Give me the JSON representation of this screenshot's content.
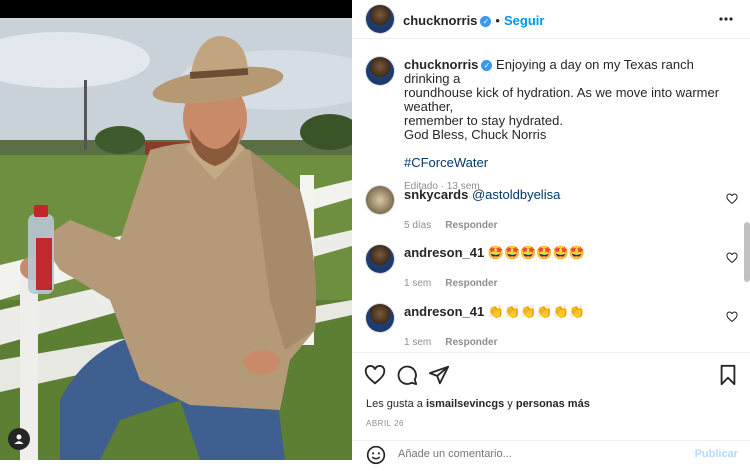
{
  "post": {
    "username": "chucknorris",
    "verified_icon": "verified-badge-icon",
    "follow_label": "Seguir",
    "separator": "•",
    "more_icon": "more-horizontal-icon"
  },
  "caption": {
    "username": "chucknorris",
    "line1": "Enjoying a day on my Texas ranch drinking a",
    "line2": "roundhouse kick of hydration. As we move into warmer weather,",
    "line3": "remember to stay hydrated.",
    "line4": "God Bless, Chuck Norris",
    "hashtag": "#CForceWater",
    "meta": "Editado · 13 sem"
  },
  "comments": [
    {
      "username": "snkycards",
      "text": "@astoldbyelisa",
      "time": "5 días",
      "reply": "Responder"
    },
    {
      "username": "andreson_41",
      "text": "🤩🤩🤩🤩🤩🤩",
      "time": "1 sem",
      "reply": "Responder"
    },
    {
      "username": "andreson_41",
      "text": "👏👏👏👏👏👏",
      "time": "1 sem",
      "reply": "Responder"
    }
  ],
  "actions": {
    "like_icon": "heart-icon",
    "comment_icon": "comment-bubble-icon",
    "share_icon": "paper-plane-icon",
    "save_icon": "bookmark-icon"
  },
  "likes": {
    "prefix": "Les gusta a",
    "user": "ismailsevincgs",
    "middle": "y",
    "others": "personas más"
  },
  "date": "ABRIL 26",
  "comment_box": {
    "placeholder": "Añade un comentario...",
    "publish_label": "Publicar",
    "emoji_icon": "emoji-smile-icon"
  },
  "colors": {
    "accent": "#0095f6",
    "verified": "#3897f0",
    "muted": "#8e8e8e"
  }
}
